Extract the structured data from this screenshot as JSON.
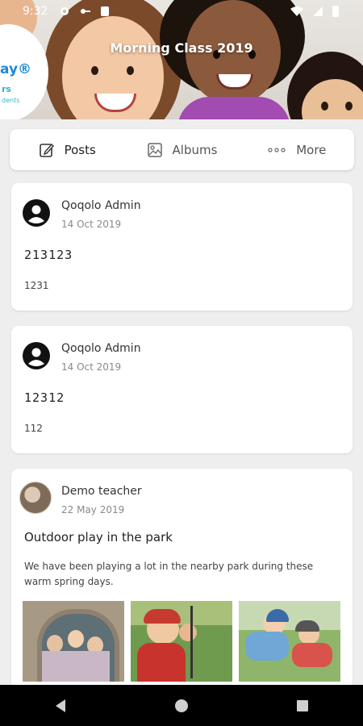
{
  "status_bar": {
    "time": "9:32"
  },
  "header": {
    "class_title": "Morning Class 2019",
    "brand_text": "ay®",
    "brand_sub": "rs",
    "brand_sub2": "dents"
  },
  "tabs": [
    {
      "label": "Posts",
      "icon": "edit-icon",
      "active": true
    },
    {
      "label": "Albums",
      "icon": "image-icon",
      "active": false
    },
    {
      "label": "More",
      "icon": "more-dots-icon",
      "active": false
    }
  ],
  "posts": [
    {
      "author": "Qoqolo Admin",
      "date": "14 Oct 2019",
      "title": "213123",
      "body": "1231",
      "avatar": "account-circle-icon"
    },
    {
      "author": "Qoqolo Admin",
      "date": "14 Oct 2019",
      "title": "12312",
      "body": "112",
      "avatar": "account-circle-icon"
    },
    {
      "author": "Demo teacher",
      "date": "22 May 2019",
      "title": "Outdoor play in the park",
      "body": "We have been playing a lot in the nearby park during these warm spring days.",
      "avatar": "teacher-avatar-photo"
    }
  ],
  "nav": {
    "back": "back-icon",
    "home": "home-icon",
    "recents": "recents-icon"
  }
}
